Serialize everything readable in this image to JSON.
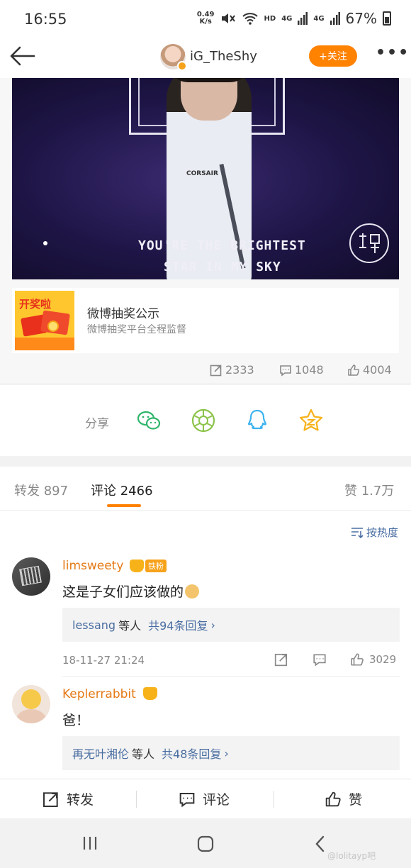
{
  "status_bar": {
    "time": "16:55",
    "net_speed": "0.49",
    "net_speed_unit": "K/s",
    "hd_label": "HD",
    "signal_label": "4G",
    "battery": "67%"
  },
  "nav": {
    "username": "iG_TheShy",
    "follow_label": "+关注"
  },
  "post": {
    "image_caption_line1": "YOU'RE THE BRIGHTEST",
    "image_caption_line2": "STAR IN MY SKY",
    "image_brand": "CORSAIR",
    "image_seal_text": "侯 鼠",
    "lottery": {
      "badge": "开奖啦",
      "title": "微博抽奖公示",
      "subtitle": "微博抽奖平台全程监督"
    },
    "stats": {
      "reposts": "2333",
      "comments": "1048",
      "likes": "4004"
    }
  },
  "share": {
    "label": "分享",
    "targets": [
      "wechat-icon",
      "moments-icon",
      "qq-icon",
      "qzone-icon"
    ]
  },
  "tabs": {
    "repost_label": "转发",
    "repost_count": "897",
    "comment_label": "评论",
    "comment_count": "2466",
    "like_label": "赞",
    "like_count": "1.7万"
  },
  "comments": {
    "sort_label": "按热度",
    "items": [
      {
        "user": "limsweety",
        "level": "5",
        "fan_badge": "铁粉",
        "text": "这是子女们应该做的",
        "reply_prefix": "lessang",
        "reply_mid": "等人",
        "reply_count": "共94条回复",
        "time": "18-11-27 21:24",
        "likes": "3029"
      },
      {
        "user": "Keplerrabbit",
        "level": "5",
        "text": "爸！",
        "reply_prefix": "再无叶湘伦",
        "reply_mid": "等人",
        "reply_count": "共48条回复"
      }
    ]
  },
  "actions": {
    "repost": "转发",
    "comment": "评论",
    "like": "赞"
  },
  "watermark": "@lolitayp吧",
  "colors": {
    "accent": "#ff8200",
    "link": "#4a6ea2",
    "username": "#e57a16"
  }
}
